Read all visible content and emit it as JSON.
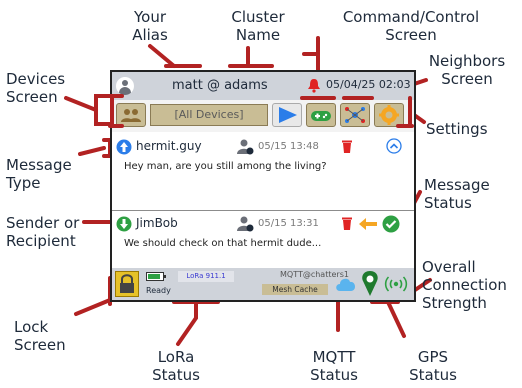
{
  "callouts": {
    "your_alias": "Your\nAlias",
    "cluster_name": "Cluster\nName",
    "command_control": "Command/Control\nScreen",
    "neighbors": "Neighbors\nScreen",
    "devices": "Devices\nScreen",
    "settings": "Settings",
    "message_type": "Message\nType",
    "message_status": "Message\nStatus",
    "sender": "Sender or\nRecipient",
    "overall": "Overall\nConnection\nStrength",
    "lock": "Lock\nScreen",
    "lora": "LoRa\nStatus",
    "mqtt": "MQTT\nStatus",
    "gps": "GPS\nStatus"
  },
  "device": {
    "alias_cluster": "matt @ adams",
    "datetime": "05/04/25 02:03",
    "device_selector": "[All Devices]",
    "messages": [
      {
        "sender": "hermit.guy",
        "date": "05/15 13:48",
        "text": "Hey man, are you still among the living?"
      },
      {
        "sender": "JimBob",
        "date": "05/15 13:31",
        "text": "We should check on that hermit dude..."
      }
    ],
    "status": {
      "ready": "Ready",
      "lora": "LoRa 911.1",
      "mqtt": "MQTT@chatters1",
      "mesh_cache": "Mesh Cache"
    }
  },
  "colors": {
    "leader": "#b22222",
    "header": "#cfd3da",
    "button": "#c9bd95",
    "accent_blue": "#2b7de9",
    "green": "#2ea043",
    "red": "#e02424",
    "orange": "#f5a623"
  }
}
